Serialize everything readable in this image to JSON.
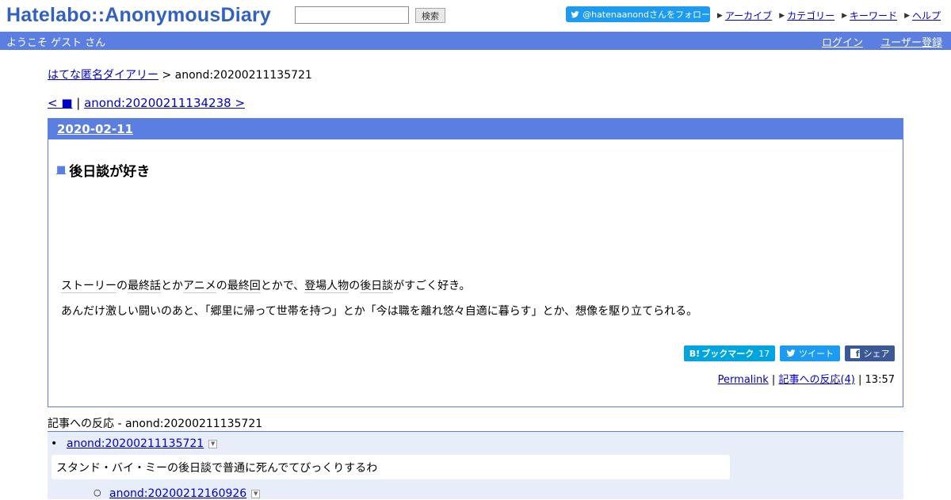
{
  "header": {
    "logo": "Hatelabo::AnonymousDiary",
    "search_value": "",
    "search_button": "検索",
    "follow": "@hatenaanondさんをフォロー",
    "links": [
      "アーカイブ",
      "カテゴリー",
      "キーワード",
      "ヘルプ"
    ]
  },
  "userbar": {
    "welcome": "ようこそ ゲスト さん",
    "login": "ログイン",
    "register": "ユーザー登録"
  },
  "breadcrumb": {
    "home": "はてな匿名ダイアリー",
    "sep": " > ",
    "current": "anond:20200211135721"
  },
  "nav": {
    "prev": "< ■",
    "sep": " | ",
    "next": "anond:20200211134238 >"
  },
  "day": {
    "date": "2020-02-11",
    "title_mark": "■",
    "title": "後日談が好き",
    "line1_parts": [
      "ストーリー",
      "の",
      "最終話",
      "とか",
      "アニメ",
      "の",
      "最終回",
      "とかで、",
      "登場人物",
      "の",
      "後日談",
      "がすごく好き。"
    ],
    "line2": "あんだけ激しい闘いのあと、「郷里に帰って世帯を持つ」とか「今は職を離れ悠々自適に暮らす」とか、想像を駆り立てられる。",
    "share": {
      "bookmark": "ブックマーク",
      "bookmark_count": "17",
      "tweet": "ツイート",
      "fb": "シェア"
    },
    "meta": {
      "permalink": "Permalink",
      "sep": " | ",
      "reactions": "記事への反応(4)",
      "time": "13:57"
    }
  },
  "reactions": {
    "title": "記事への反応 - anond:20200211135721",
    "items": [
      {
        "link": "anond:20200211135721",
        "quote": "スタンド・バイ・ミーの後日談で普通に死んでてびっくりするわ"
      },
      {
        "link": "anond:20200212160926"
      }
    ]
  },
  "colors": {
    "brand": "#5b7fe0",
    "logo": "#3162c3",
    "hatena_bookmark": "#00a4de",
    "twitter": "#1d9bf0",
    "facebook": "#3b5998"
  },
  "icons": [
    "twitter-icon",
    "arrow-icon",
    "facebook-icon",
    "dropdown-icon"
  ]
}
